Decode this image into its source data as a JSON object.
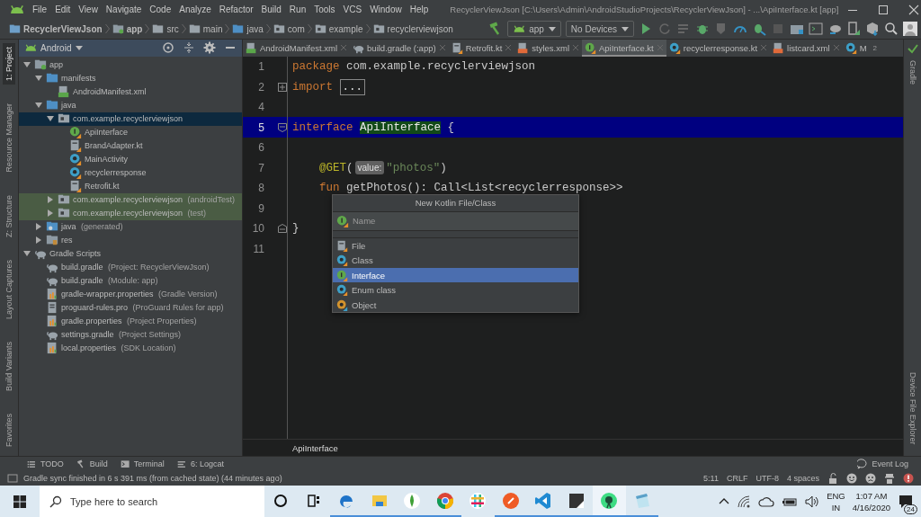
{
  "title_bar": {
    "menu": [
      "File",
      "Edit",
      "View",
      "Navigate",
      "Code",
      "Analyze",
      "Refactor",
      "Build",
      "Run",
      "Tools",
      "VCS",
      "Window",
      "Help"
    ],
    "title": "RecyclerViewJson [C:\\Users\\Admin\\AndroidStudioProjects\\RecyclerViewJson] - ...\\ApiInterface.kt [app]"
  },
  "nav_bar": {
    "breadcrumbs": [
      {
        "label": "RecyclerViewJson",
        "kind": "project",
        "bold": true
      },
      {
        "label": "app",
        "kind": "module",
        "bold": true
      },
      {
        "label": "src",
        "kind": "folder-plain",
        "bold": false
      },
      {
        "label": "main",
        "kind": "folder-plain",
        "bold": false
      },
      {
        "label": "java",
        "kind": "folder",
        "bold": false
      },
      {
        "label": "com",
        "kind": "package",
        "bold": false
      },
      {
        "label": "example",
        "kind": "package",
        "bold": false
      },
      {
        "label": "recyclerviewjson",
        "kind": "package",
        "bold": false
      }
    ],
    "run_config": "app",
    "device": "No Devices"
  },
  "left_stripe": [
    {
      "label": "1: Project",
      "selected": true
    },
    {
      "label": "Resource Manager",
      "selected": false
    },
    {
      "label": "Z: Structure",
      "selected": false
    },
    {
      "label": "Layout Captures",
      "selected": false
    },
    {
      "label": "Build Variants",
      "selected": false
    },
    {
      "label": "Favorites",
      "selected": false
    }
  ],
  "right_stripe": [
    "Gradle",
    "Device File Explorer"
  ],
  "project_panel": {
    "view": "Android",
    "tree": [
      {
        "label": "app",
        "kind": "module",
        "expanded": true,
        "selected": false,
        "children": [
          {
            "label": "manifests",
            "kind": "folder",
            "expanded": true,
            "selected": false,
            "children": [
              {
                "label": "AndroidManifest.xml",
                "kind": "manifest",
                "selected": false
              }
            ]
          },
          {
            "label": "java",
            "kind": "folder",
            "expanded": true,
            "selected": false,
            "children": [
              {
                "label": "com.example.recyclerviewjson",
                "kind": "package",
                "expanded": true,
                "selected": true,
                "tinted": false,
                "children": [
                  {
                    "label": "ApiInterface",
                    "kind": "kotlin-interface",
                    "selected": false
                  },
                  {
                    "label": "BrandAdapter.kt",
                    "kind": "kotlin-file",
                    "selected": false
                  },
                  {
                    "label": "MainActivity",
                    "kind": "kotlin-class",
                    "selected": false
                  },
                  {
                    "label": "recyclerresponse",
                    "kind": "kotlin-class",
                    "selected": false
                  },
                  {
                    "label": "Retrofit.kt",
                    "kind": "kotlin-file",
                    "selected": false
                  }
                ]
              },
              {
                "label": "com.example.recyclerviewjson",
                "hint": "(androidTest)",
                "kind": "package",
                "expanded": false,
                "selected": false,
                "tinted": true
              },
              {
                "label": "com.example.recyclerviewjson",
                "hint": "(test)",
                "kind": "package",
                "expanded": false,
                "selected": false,
                "tinted": true
              }
            ]
          },
          {
            "label": "java",
            "hint": "(generated)",
            "kind": "folder-generated",
            "expanded": false,
            "selected": false
          },
          {
            "label": "res",
            "kind": "folder-res",
            "expanded": false,
            "selected": false
          }
        ]
      },
      {
        "label": "Gradle Scripts",
        "kind": "gradle",
        "expanded": true,
        "selected": false,
        "children": [
          {
            "label": "build.gradle",
            "hint": "(Project: RecyclerViewJson)",
            "kind": "gradle",
            "selected": false
          },
          {
            "label": "build.gradle",
            "hint": "(Module: app)",
            "kind": "gradle",
            "selected": false
          },
          {
            "label": "gradle-wrapper.properties",
            "hint": "(Gradle Version)",
            "kind": "properties",
            "selected": false
          },
          {
            "label": "proguard-rules.pro",
            "hint": "(ProGuard Rules for app)",
            "kind": "file",
            "selected": false
          },
          {
            "label": "gradle.properties",
            "hint": "(Project Properties)",
            "kind": "properties",
            "selected": false
          },
          {
            "label": "settings.gradle",
            "hint": "(Project Settings)",
            "kind": "gradle",
            "selected": false
          },
          {
            "label": "local.properties",
            "hint": "(SDK Location)",
            "kind": "properties",
            "selected": false
          }
        ]
      }
    ]
  },
  "editor": {
    "tabs": [
      {
        "label": "AndroidManifest.xml",
        "kind": "manifest",
        "selected": false
      },
      {
        "label": "build.gradle (:app)",
        "kind": "gradle",
        "selected": false
      },
      {
        "label": "Retrofit.kt",
        "kind": "kotlin-file",
        "selected": false
      },
      {
        "label": "styles.xml",
        "kind": "xml",
        "selected": false
      },
      {
        "label": "ApiInterface.kt",
        "kind": "kotlin-interface",
        "selected": true
      },
      {
        "label": "recyclerresponse.kt",
        "kind": "kotlin-class",
        "selected": false
      },
      {
        "label": "listcard.xml",
        "kind": "xml",
        "selected": false
      },
      {
        "label": "M",
        "kind": "kotlin-class",
        "selected": false
      }
    ],
    "hidden_tab_count": "2",
    "lines": [
      {
        "number": "1",
        "current": false,
        "segments": [
          {
            "kind": "keyword",
            "text": "package"
          },
          {
            "kind": "plain",
            "text": " com.example.recyclerviewjson"
          }
        ]
      },
      {
        "number": "2",
        "current": false,
        "fold": {
          "kind": "start",
          "collapsed": true
        },
        "segments": [
          {
            "kind": "keyword",
            "text": "import"
          },
          {
            "kind": "folded",
            "text": "..."
          }
        ]
      },
      {
        "number": "4",
        "current": false
      },
      {
        "number": "5",
        "current": true,
        "fold": {
          "kind": "start",
          "collapsed": false
        },
        "segments": [
          {
            "kind": "keyword",
            "text": "interface"
          },
          {
            "kind": "declaration",
            "text": "ApiInterface"
          },
          {
            "kind": "plain",
            "text": " {"
          }
        ]
      },
      {
        "number": "6",
        "current": false
      },
      {
        "number": "7",
        "current": false,
        "segments": [
          {
            "kind": "annotation",
            "text": "    @GET"
          },
          {
            "kind": "plain",
            "text": "("
          },
          {
            "kind": "hint",
            "text": "value:"
          },
          {
            "kind": "string",
            "text": "\"photos\""
          },
          {
            "kind": "plain",
            "text": ")"
          }
        ]
      },
      {
        "number": "8",
        "current": false,
        "segments": [
          {
            "kind": "keyword",
            "text": "    fun"
          },
          {
            "kind": "plain",
            "text": " getPhotos(): Call<List<recyclerresponse>>"
          }
        ]
      },
      {
        "number": "9",
        "current": false
      },
      {
        "number": "10",
        "current": false,
        "fold": {
          "kind": "end",
          "collapsed": false
        },
        "segments": [
          {
            "kind": "plain",
            "text": "}"
          }
        ]
      },
      {
        "number": "11",
        "current": false
      }
    ],
    "breadcrumb": "ApiInterface"
  },
  "popup": {
    "title": "New Kotlin File/Class",
    "placeholder": "Name",
    "items": [
      {
        "label": "File",
        "kind": "kotlin-file",
        "selected": false
      },
      {
        "label": "Class",
        "kind": "kotlin-class",
        "selected": false
      },
      {
        "label": "Interface",
        "kind": "kotlin-interface",
        "selected": true
      },
      {
        "label": "Enum class",
        "kind": "kotlin-class",
        "selected": false
      },
      {
        "label": "Object",
        "kind": "kotlin-object",
        "selected": false
      }
    ]
  },
  "tool_windows": [
    {
      "label": "TODO",
      "kind": "list"
    },
    {
      "label": "Build",
      "kind": "hammer"
    },
    {
      "label": "Terminal",
      "kind": "terminal"
    },
    {
      "label": "6: Logcat",
      "kind": "lines"
    }
  ],
  "event_log": "Event Log",
  "status_bar": {
    "message": "Gradle sync finished in 6 s 391 ms (from cached state) (44 minutes ago)",
    "items": [
      "5:11",
      "CRLF",
      "UTF-8",
      "4 spaces"
    ]
  },
  "taskbar": {
    "search_placeholder": "Type here to search",
    "apps": [
      {
        "kind": "ring",
        "active": false
      },
      {
        "kind": "taskview",
        "active": false
      },
      {
        "kind": "edge",
        "active": true
      },
      {
        "kind": "explorer",
        "active": true
      },
      {
        "kind": "leaf",
        "active": true
      },
      {
        "kind": "chrome",
        "active": true
      },
      {
        "kind": "slack",
        "active": false
      },
      {
        "kind": "postman",
        "active": true
      },
      {
        "kind": "vscode",
        "active": true
      },
      {
        "kind": "sticky",
        "active": true
      },
      {
        "kind": "studio",
        "active": true
      },
      {
        "kind": "notepad",
        "active": true
      }
    ],
    "language": [
      "ENG",
      "IN"
    ],
    "time": "1:07 AM",
    "date": "4/16/2020",
    "notifications": "24"
  }
}
